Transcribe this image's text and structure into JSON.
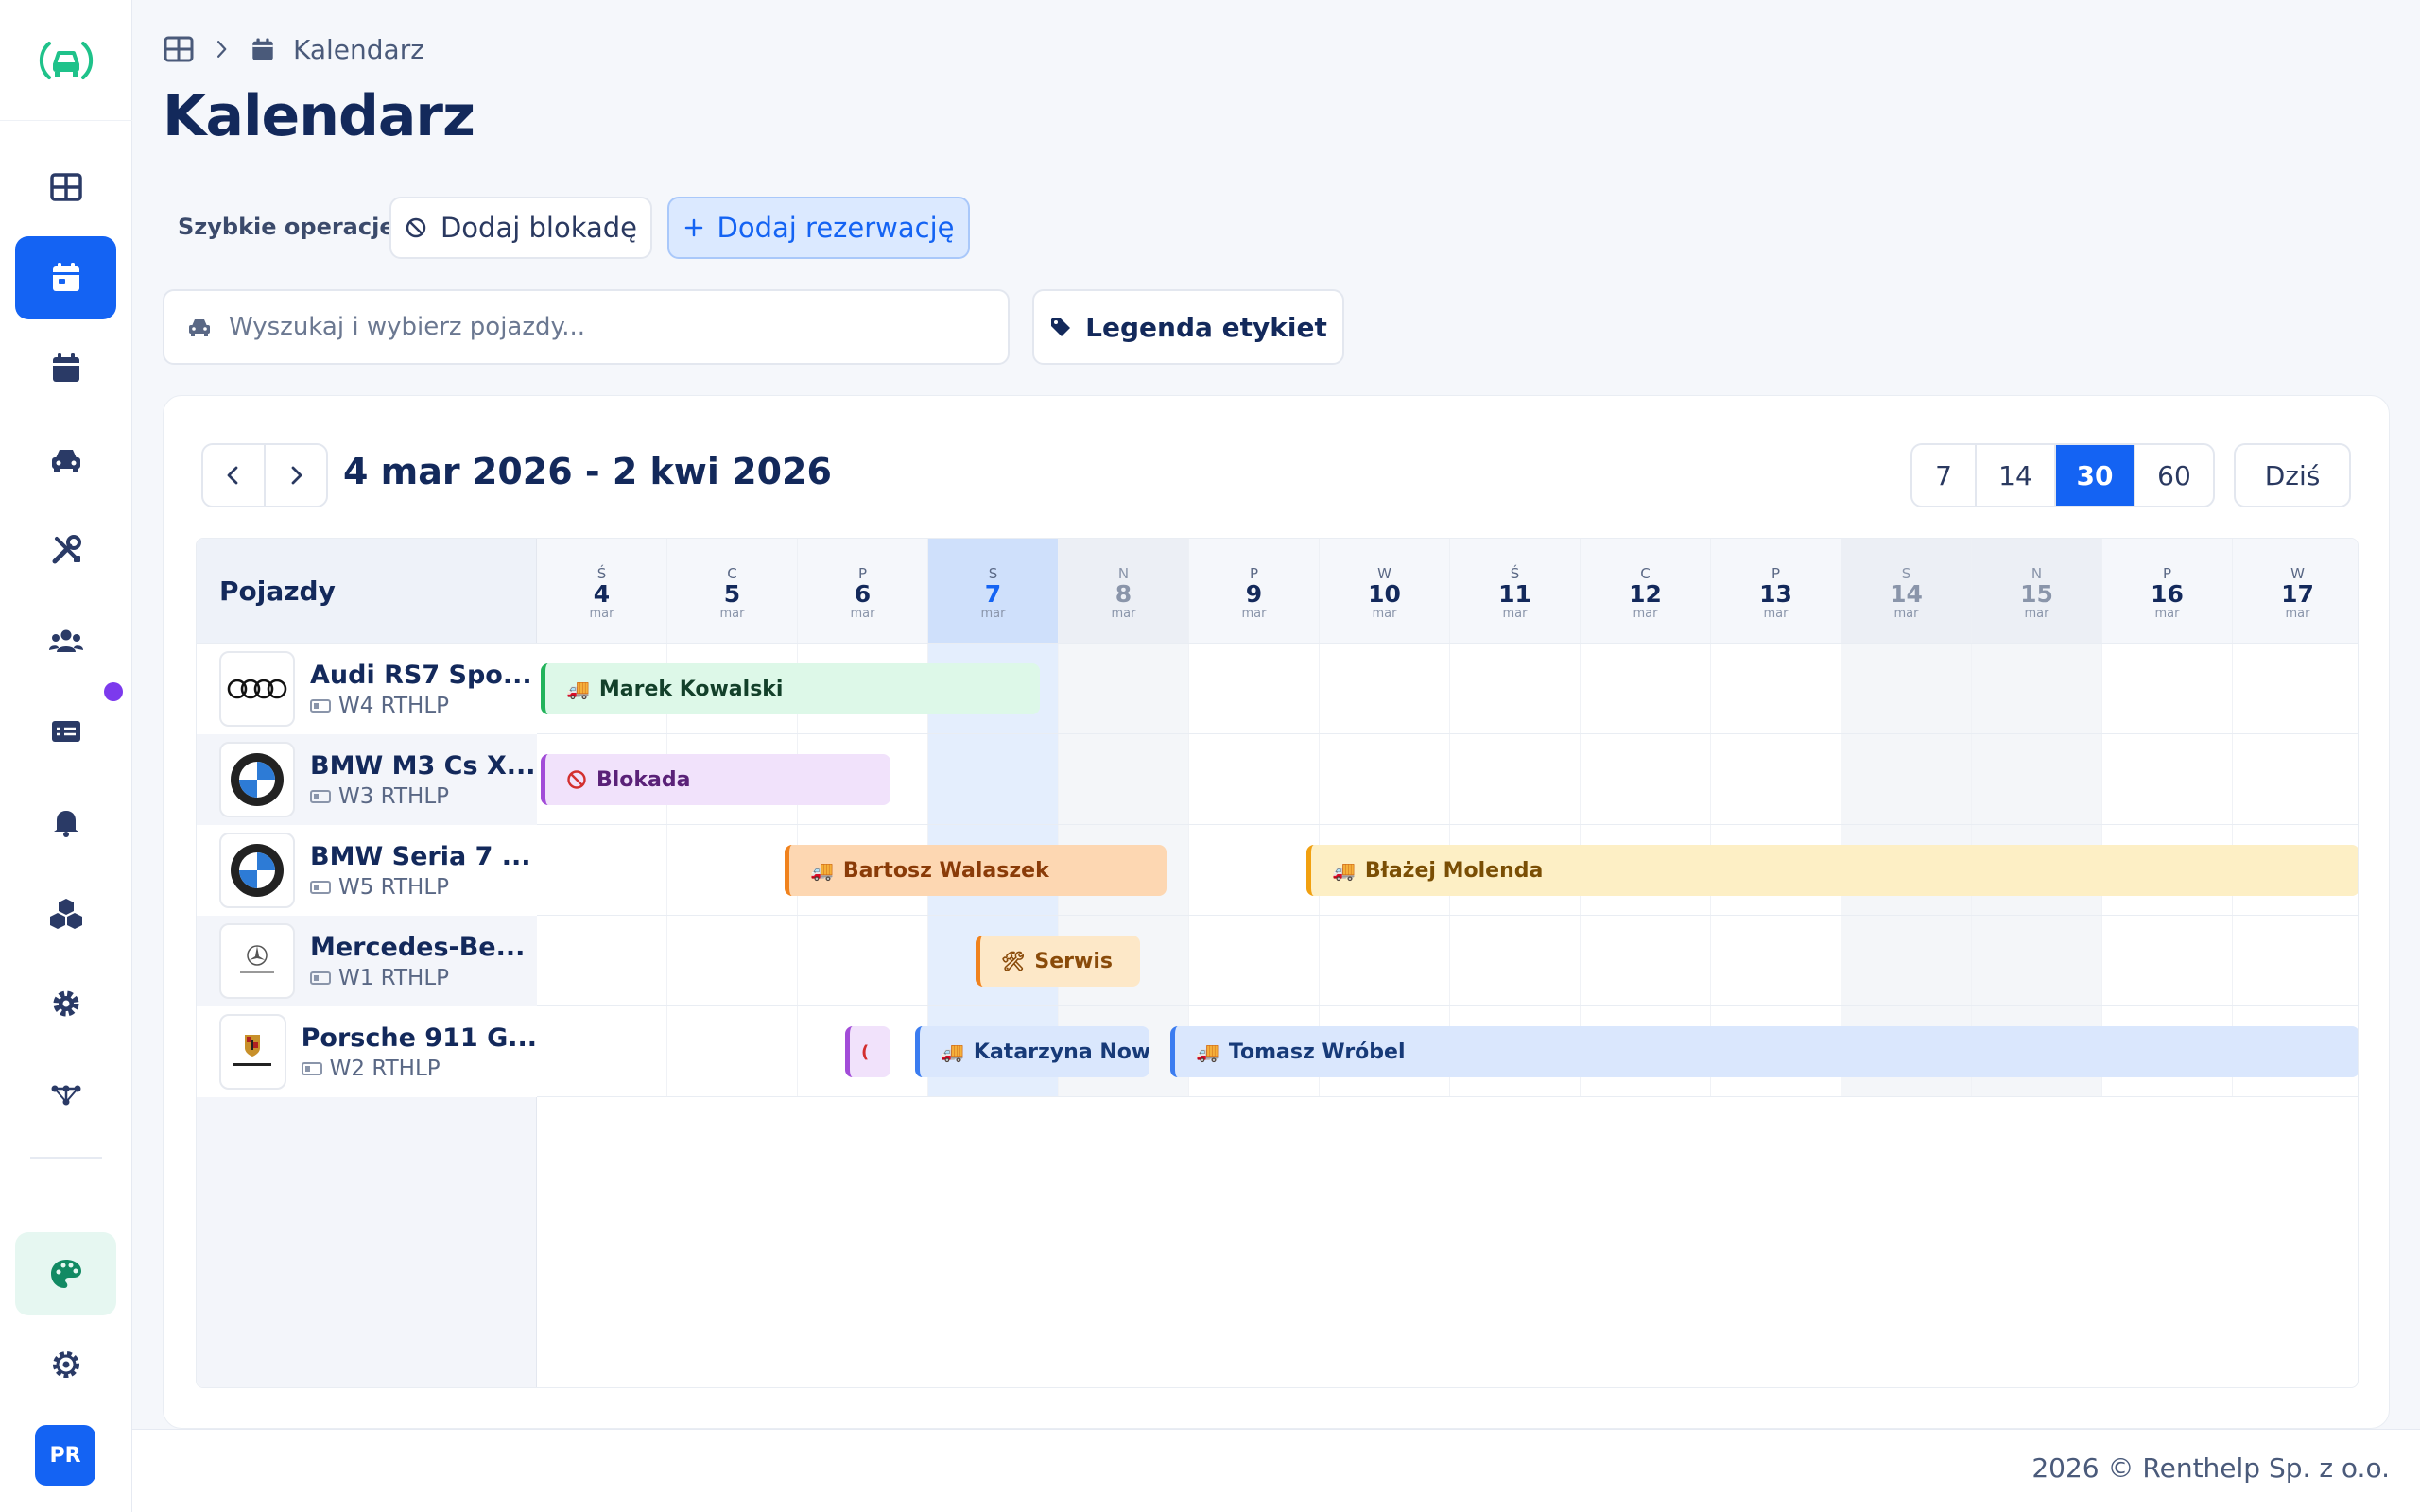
{
  "app": {
    "avatar_initials": "PR"
  },
  "breadcrumb": {
    "current": "Kalendarz"
  },
  "page": {
    "title": "Kalendarz"
  },
  "quick_ops": {
    "label": "Szybkie operacje:",
    "block_label": "Dodaj blokadę",
    "reserve_label": "Dodaj rezerwację"
  },
  "search": {
    "placeholder": "Wyszukaj i wybierz pojazdy..."
  },
  "legend": {
    "label": "Legenda etykiet"
  },
  "calendar": {
    "range": "4 mar 2026 - 2 kwi 2026",
    "views": [
      "7",
      "14",
      "30",
      "60"
    ],
    "active_view": "30",
    "today_label": "Dziś",
    "vehicles_header": "Pojazdy",
    "days": [
      {
        "dn": "Ś",
        "dd": "4",
        "dm": "mar"
      },
      {
        "dn": "C",
        "dd": "5",
        "dm": "mar"
      },
      {
        "dn": "P",
        "dd": "6",
        "dm": "mar"
      },
      {
        "dn": "S",
        "dd": "7",
        "dm": "mar"
      },
      {
        "dn": "N",
        "dd": "8",
        "dm": "mar"
      },
      {
        "dn": "P",
        "dd": "9",
        "dm": "mar"
      },
      {
        "dn": "W",
        "dd": "10",
        "dm": "mar"
      },
      {
        "dn": "Ś",
        "dd": "11",
        "dm": "mar"
      },
      {
        "dn": "C",
        "dd": "12",
        "dm": "mar"
      },
      {
        "dn": "P",
        "dd": "13",
        "dm": "mar"
      },
      {
        "dn": "S",
        "dd": "14",
        "dm": "mar"
      },
      {
        "dn": "N",
        "dd": "15",
        "dm": "mar"
      },
      {
        "dn": "P",
        "dd": "16",
        "dm": "mar"
      },
      {
        "dn": "W",
        "dd": "17",
        "dm": "mar"
      }
    ],
    "vehicles": [
      {
        "name": "Audi RS7 Spo...",
        "plate": "W4 RTHLP"
      },
      {
        "name": "BMW M3 Cs X...",
        "plate": "W3 RTHLP"
      },
      {
        "name": "BMW Seria 7 ...",
        "plate": "W5 RTHLP"
      },
      {
        "name": "Mercedes-Be...",
        "plate": "W1 RTHLP"
      },
      {
        "name": "Porsche 911 G...",
        "plate": "W2 RTHLP"
      }
    ],
    "events": [
      {
        "label": "Marek Kowalski",
        "icon": "truck-icon"
      },
      {
        "label": "Blokada",
        "icon": "ban-icon"
      },
      {
        "label": "Bartosz Walaszek",
        "icon": "truck-icon"
      },
      {
        "label": "Błażej Molenda",
        "icon": "truck-icon"
      },
      {
        "label": "Serwis",
        "icon": "tools-icon"
      },
      {
        "label": "Katarzyna Now...",
        "icon": "truck-icon"
      },
      {
        "label": "Tomasz Wróbel",
        "icon": "truck-icon"
      }
    ]
  },
  "footer": {
    "text": "2026 © Renthelp Sp. z o.o."
  },
  "colors": {
    "accent": "#1463f3",
    "brand_green": "#1fc28a"
  }
}
